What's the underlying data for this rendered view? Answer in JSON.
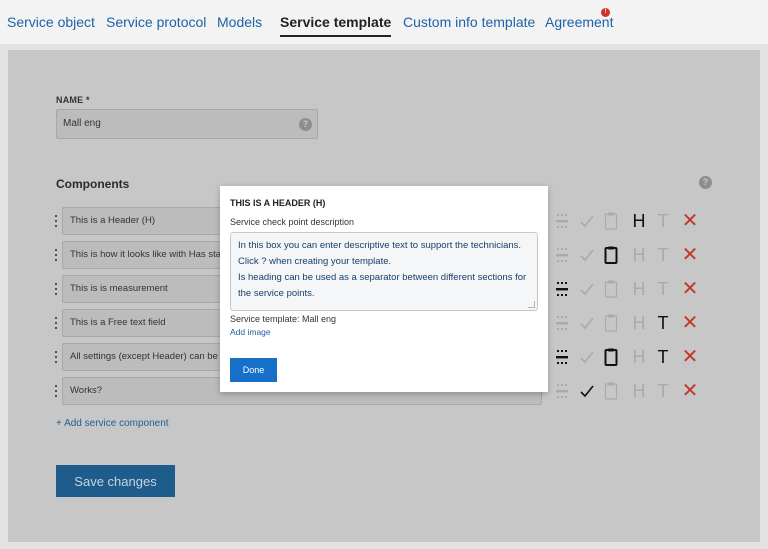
{
  "nav": {
    "tabs": [
      {
        "label": "Service object"
      },
      {
        "label": "Service protocol"
      },
      {
        "label": "Models"
      },
      {
        "label": "Service template"
      },
      {
        "label": "Custom info template"
      },
      {
        "label": "Agreement"
      }
    ],
    "active_tab": "Service template",
    "agreement_badge": "!"
  },
  "form": {
    "name_label": "NAME *",
    "name_value": "Mall eng",
    "help_glyph": "?",
    "components_title": "Components",
    "rows": [
      {
        "text": "This is a Header (H)",
        "icons": {
          "separator": "off",
          "check": "off",
          "clipboard": "off",
          "h": "on",
          "t": "off"
        }
      },
      {
        "text": "This is how it looks like with Has sta",
        "icons": {
          "separator": "off",
          "check": "off",
          "clipboard": "on",
          "h": "off",
          "t": "off"
        }
      },
      {
        "text": "This is is measurement",
        "icons": {
          "separator": "on",
          "check": "off",
          "clipboard": "off",
          "h": "off",
          "t": "off"
        }
      },
      {
        "text": "This is a Free text field",
        "icons": {
          "separator": "off",
          "check": "off",
          "clipboard": "off",
          "h": "off",
          "t": "on"
        }
      },
      {
        "text": "All settings (except Header) can be",
        "icons": {
          "separator": "on",
          "check": "off",
          "clipboard": "on",
          "h": "off",
          "t": "on"
        }
      },
      {
        "text": "Works?",
        "icons": {
          "separator": "off",
          "check": "on",
          "clipboard": "off",
          "h": "off",
          "t": "off"
        }
      }
    ],
    "add_component_label": "+ Add service component",
    "save_label": "Save changes"
  },
  "modal": {
    "title": "THIS IS A HEADER (H)",
    "description_label": "Service check point description",
    "description_lines": [
      "In this box you can enter descriptive text to support the technicians.",
      "Click ? when creating your template.",
      "Is heading can be used as a separator between different sections for",
      "the service points."
    ],
    "template_text": "Service template: Mall eng",
    "add_image_label": "Add image",
    "done_label": "Done"
  },
  "icon_glyphs": {
    "h": "H",
    "t": "T",
    "x": "✕"
  },
  "colors": {
    "link": "#1c63a8",
    "primary_button": "#1670c9",
    "delete": "#c0392b",
    "badge": "#d0312d"
  }
}
